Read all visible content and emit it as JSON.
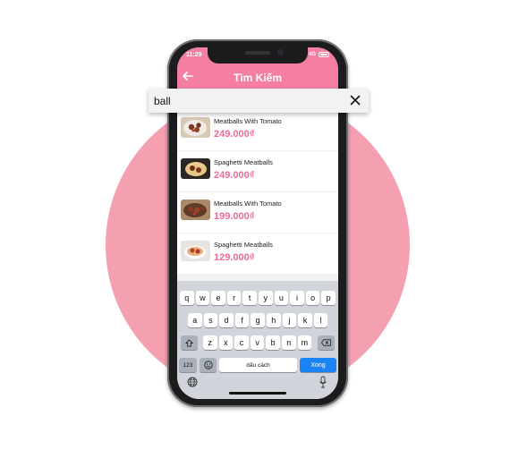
{
  "status_bar": {
    "time": "11:29",
    "network": "4G"
  },
  "header": {
    "title": "Tìm Kiếm",
    "back_icon": "arrow-left-icon"
  },
  "search": {
    "value": "ball",
    "clear_icon": "close-icon"
  },
  "results": [
    {
      "name": "Meatballs With Tomato",
      "price": "249.000₫"
    },
    {
      "name": "Spaghetti Meatballs",
      "price": "249.000₫"
    },
    {
      "name": "Meatballs With Tomato",
      "price": "199.000₫"
    },
    {
      "name": "Spaghetti Meatballs",
      "price": "129.000₫"
    }
  ],
  "keyboard": {
    "row1": [
      "q",
      "w",
      "e",
      "r",
      "t",
      "y",
      "u",
      "i",
      "o",
      "p"
    ],
    "row2": [
      "a",
      "s",
      "d",
      "f",
      "g",
      "h",
      "j",
      "k",
      "l"
    ],
    "row3": [
      "z",
      "x",
      "c",
      "v",
      "b",
      "n",
      "m"
    ],
    "numbers_key": "123",
    "space_key": "dấu cách",
    "return_key": "Xong",
    "emoji_icon": "emoji-icon",
    "globe_icon": "globe-icon",
    "mic_icon": "microphone-icon",
    "shift_icon": "shift-icon",
    "delete_icon": "backspace-icon"
  },
  "colors": {
    "accent": "#f47fa2",
    "price": "#ec6b96",
    "background_circle": "#f5a0b1",
    "return_key": "#1a84f7"
  }
}
